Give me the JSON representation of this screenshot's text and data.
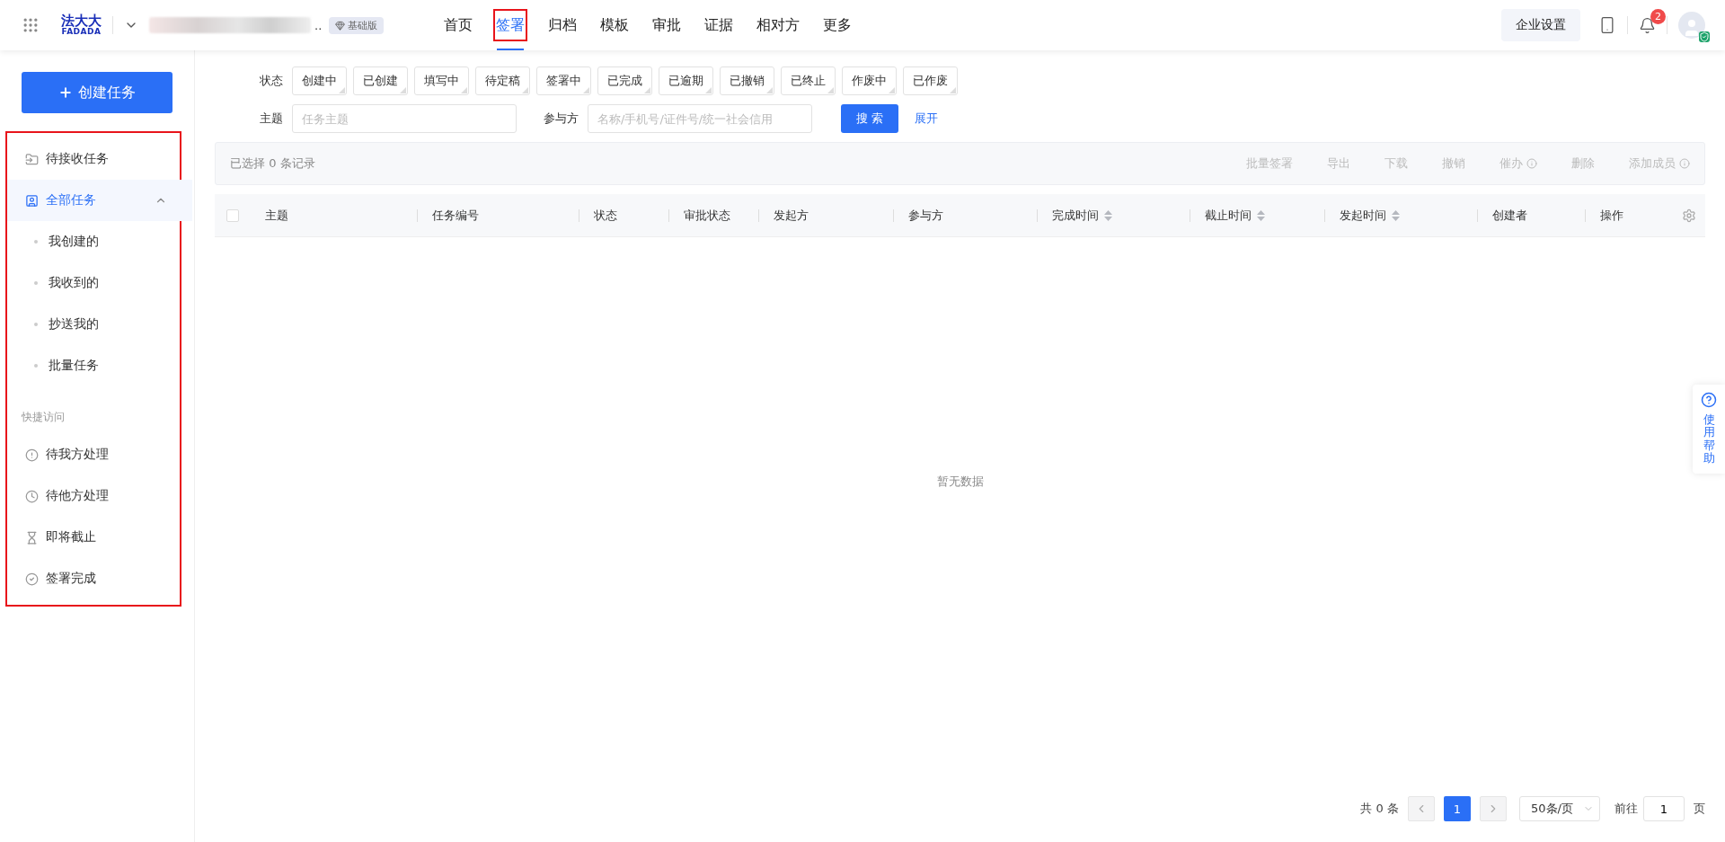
{
  "header": {
    "logo": {
      "cn": "法大大",
      "en": "FADADA"
    },
    "company_suffix": "..",
    "plan_badge": "基础版",
    "nav": [
      {
        "label": "首页",
        "selected": false,
        "highlighted": false
      },
      {
        "label": "签署",
        "selected": true,
        "highlighted": true
      },
      {
        "label": "归档",
        "selected": false,
        "highlighted": false
      },
      {
        "label": "模板",
        "selected": false,
        "highlighted": false
      },
      {
        "label": "审批",
        "selected": false,
        "highlighted": false
      },
      {
        "label": "证据",
        "selected": false,
        "highlighted": false
      },
      {
        "label": "相对方",
        "selected": false,
        "highlighted": false
      },
      {
        "label": "更多",
        "selected": false,
        "highlighted": false
      }
    ],
    "settings_button": "企业设置",
    "notification_count": "2"
  },
  "sidebar": {
    "create_button": "创建任务",
    "highlighted": true,
    "items": [
      {
        "kind": "folder",
        "label": "待接收任务",
        "selected": false
      },
      {
        "kind": "group",
        "label": "全部任务",
        "selected": true,
        "expanded": true,
        "children": [
          {
            "label": "我创建的",
            "selected": false
          },
          {
            "label": "我收到的",
            "selected": false
          },
          {
            "label": "抄送我的",
            "selected": false
          },
          {
            "label": "批量任务",
            "selected": false
          }
        ]
      }
    ],
    "quick_title": "快捷访问",
    "quick_items": [
      {
        "kind": "alert",
        "label": "待我方处理"
      },
      {
        "kind": "clock",
        "label": "待他方处理"
      },
      {
        "kind": "hourglass",
        "label": "即将截止"
      },
      {
        "kind": "check",
        "label": "签署完成"
      }
    ]
  },
  "filters": {
    "status_label": "状态",
    "statuses": [
      {
        "label": "创建中",
        "selected": false
      },
      {
        "label": "已创建",
        "selected": false
      },
      {
        "label": "填写中",
        "selected": false
      },
      {
        "label": "待定稿",
        "selected": false
      },
      {
        "label": "签署中",
        "selected": false
      },
      {
        "label": "已完成",
        "selected": false
      },
      {
        "label": "已逾期",
        "selected": false
      },
      {
        "label": "已撤销",
        "selected": false
      },
      {
        "label": "已终止",
        "selected": false
      },
      {
        "label": "作废中",
        "selected": false
      },
      {
        "label": "已作废",
        "selected": false
      }
    ],
    "subject_label": "主题",
    "subject_placeholder": "任务主题",
    "party_label": "参与方",
    "party_placeholder": "名称/手机号/证件号/统一社会信用",
    "search_button": "搜 索",
    "expand_link": "展开"
  },
  "toolbar": {
    "selection": "已选择 0 条记录",
    "actions": [
      {
        "label": "批量签署",
        "disabled": true,
        "info": false
      },
      {
        "label": "导出",
        "disabled": true,
        "info": false
      },
      {
        "label": "下载",
        "disabled": true,
        "info": false
      },
      {
        "label": "撤销",
        "disabled": true,
        "info": false
      },
      {
        "label": "催办",
        "disabled": true,
        "info": true
      },
      {
        "label": "删除",
        "disabled": true,
        "info": false
      },
      {
        "label": "添加成员",
        "disabled": true,
        "info": true
      }
    ]
  },
  "table": {
    "select_all_checked": false,
    "columns": [
      {
        "label": "主题",
        "sortable": false
      },
      {
        "label": "任务编号",
        "sortable": false
      },
      {
        "label": "状态",
        "sortable": false
      },
      {
        "label": "审批状态",
        "sortable": false
      },
      {
        "label": "发起方",
        "sortable": false
      },
      {
        "label": "参与方",
        "sortable": false
      },
      {
        "label": "完成时间",
        "sortable": true
      },
      {
        "label": "截止时间",
        "sortable": true
      },
      {
        "label": "发起时间",
        "sortable": true
      },
      {
        "label": "创建者",
        "sortable": false
      },
      {
        "label": "操作",
        "sortable": false
      }
    ],
    "empty_text": "暂无数据"
  },
  "pagination": {
    "total": "共 0 条",
    "pages": [
      {
        "label": "1",
        "selected": true
      }
    ],
    "page_size": "50条/页",
    "goto_label": "前往",
    "goto_value": "1",
    "page_unit": "页"
  },
  "help": {
    "label": "使用帮助"
  }
}
